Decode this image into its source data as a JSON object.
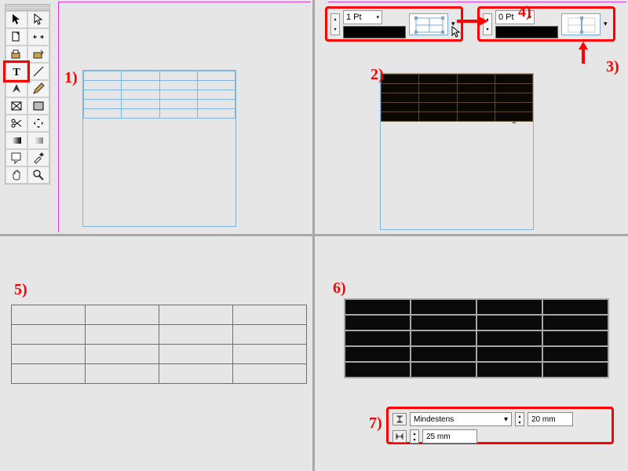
{
  "callouts": {
    "c1": "1)",
    "c2": "2)",
    "c3": "3)",
    "c4": "4)",
    "c5": "5)",
    "c6": "6)",
    "c7": "7)"
  },
  "stroke_panel_left": {
    "weight": "1 Pt"
  },
  "stroke_panel_right": {
    "weight": "0 Pt"
  },
  "row_height_panel": {
    "mode_label": "Mindestens",
    "height_value": "20 mm",
    "width_value": "25 mm"
  },
  "table_structure": {
    "rows": 5,
    "cols": 4
  },
  "tools": [
    [
      "selection",
      "direct-selection"
    ],
    [
      "page",
      "gap"
    ],
    [
      "content-grabber",
      "content-placer"
    ],
    [
      "type",
      "line"
    ],
    [
      "pen",
      "pencil"
    ],
    [
      "rectangle-frame",
      "rectangle"
    ],
    [
      "scissors",
      "free-transform"
    ],
    [
      "gradient-swatch",
      "gradient-feather"
    ],
    [
      "note",
      "eyedropper"
    ],
    [
      "hand",
      "zoom"
    ]
  ],
  "glyphs": {
    "dropdown": "▾",
    "up": "▴",
    "down": "▾"
  }
}
